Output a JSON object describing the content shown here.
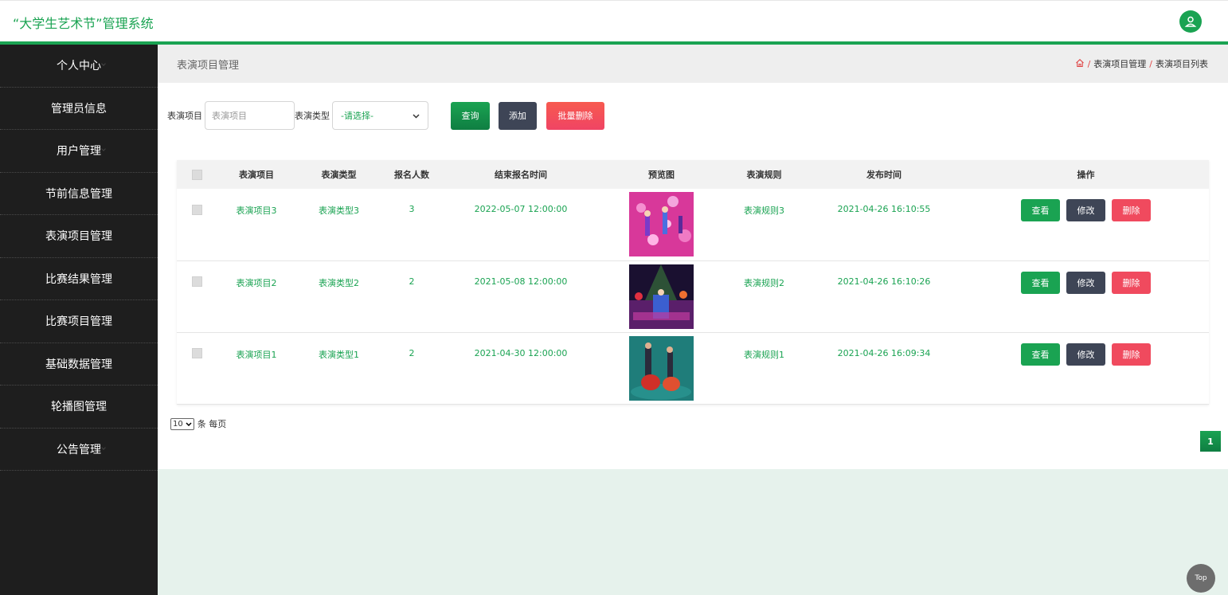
{
  "app": {
    "title": "“大学生艺术节”管理系统"
  },
  "colors": {
    "brand": "#1aa352",
    "sidebar": "#1e1e1e",
    "edit": "#3e4556",
    "danger": "#f04a5e"
  },
  "sidebar": {
    "items": [
      {
        "label": "个人中心"
      },
      {
        "label": "管理员信息"
      },
      {
        "label": "用户管理"
      },
      {
        "label": "节前信息管理"
      },
      {
        "label": "表演项目管理"
      },
      {
        "label": "比赛结果管理"
      },
      {
        "label": "比赛项目管理"
      },
      {
        "label": "基础数据管理"
      },
      {
        "label": "轮播图管理"
      },
      {
        "label": "公告管理"
      }
    ]
  },
  "header": {
    "page_title": "表演项目管理",
    "breadcrumb": [
      "表演项目管理",
      "表演项目列表"
    ],
    "breadcrumb_sep": "/"
  },
  "search": {
    "project_label": "表演项目",
    "project_placeholder": "表演项目",
    "type_label": "表演类型",
    "type_selected": "-请选择-",
    "query_label": "查询",
    "add_label": "添加",
    "batch_delete_label": "批量删除"
  },
  "table": {
    "headers": [
      "表演项目",
      "表演类型",
      "报名人数",
      "结束报名时间",
      "预览图",
      "表演规则",
      "发布时间",
      "操作"
    ],
    "rows": [
      {
        "name": "表演项目3",
        "type": "表演类型3",
        "count": "3",
        "deadline": "2022-05-07 12:00:00",
        "rule": "表演规则3",
        "published": "2021-04-26 16:10:55"
      },
      {
        "name": "表演项目2",
        "type": "表演类型2",
        "count": "2",
        "deadline": "2021-05-08 12:00:00",
        "rule": "表演规则2",
        "published": "2021-04-26 16:10:26"
      },
      {
        "name": "表演项目1",
        "type": "表演类型1",
        "count": "2",
        "deadline": "2021-04-30 12:00:00",
        "rule": "表演规则1",
        "published": "2021-04-26 16:09:34"
      }
    ],
    "actions": {
      "view": "查看",
      "edit": "修改",
      "delete": "删除"
    }
  },
  "pagination": {
    "page_size": "10",
    "per_page_label": "条 每页",
    "current_page": "1"
  },
  "scroll_top": {
    "label": "Top"
  }
}
